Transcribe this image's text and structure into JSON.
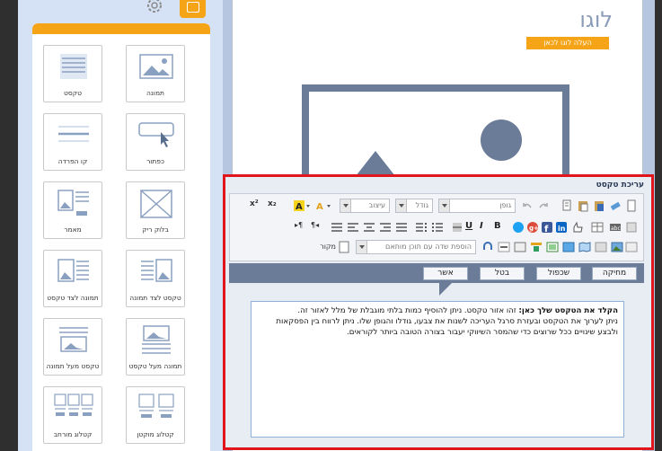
{
  "sidebar": {
    "tiles": [
      {
        "label": "תמונה",
        "icon": "image-icon"
      },
      {
        "label": "טקסט",
        "icon": "text-icon"
      },
      {
        "label": "כפתור",
        "icon": "button-icon"
      },
      {
        "label": "קו הפרדה",
        "icon": "divider-icon"
      },
      {
        "label": "בלוק ריק",
        "icon": "empty-block-icon"
      },
      {
        "label": "מאמר",
        "icon": "article-icon"
      },
      {
        "label": "טקסט לצד תמונה",
        "icon": "text-beside-image-icon"
      },
      {
        "label": "תמונה לצד טקסט",
        "icon": "image-beside-text-icon"
      },
      {
        "label": "תמונה מעל טקסט",
        "icon": "image-above-text-icon"
      },
      {
        "label": "טקסט מעל תמונה",
        "icon": "text-above-image-icon"
      },
      {
        "label": "קטלוג מוקטן",
        "icon": "small-catalog-icon"
      },
      {
        "label": "קטלוג מורחב",
        "icon": "wide-catalog-icon"
      }
    ]
  },
  "canvas": {
    "logo_text": "לוגו",
    "logo_upload": "העלה לוגו לכאן"
  },
  "editor": {
    "title": "עריכת טקסט",
    "font_combo": "גופן",
    "size_combo": "גודל",
    "format_combo": "עיצוב",
    "field_combo": "הוספת שדה עם תוכן מותאם",
    "source_label": "מקור",
    "actions": {
      "delete": "מחיקה",
      "duplicate": "שכפול",
      "cancel": "בטל",
      "confirm": "אשר"
    },
    "content_bold": "הקלד את הטקסט שלך כאן:",
    "content_line1": " זהו אזור טקסט. ניתן להוסיף כמות בלתי מוגבלת של מלל לאזור זה.",
    "content_line2": "ניתן לערוך את הטקסט ובעזרת סרגל העריכה לשנות את צבעו, גודלו והגופן שלו. ניתן לרווח בין הפסקאות ולבצע שינויים ככל שרוצים כדי שהמסר השיווקי יעבור בצורה הטובה ביותר לקוראים."
  },
  "colors": {
    "accent": "#f5a418",
    "frame": "#e0161c",
    "slate": "#6b7c99"
  }
}
